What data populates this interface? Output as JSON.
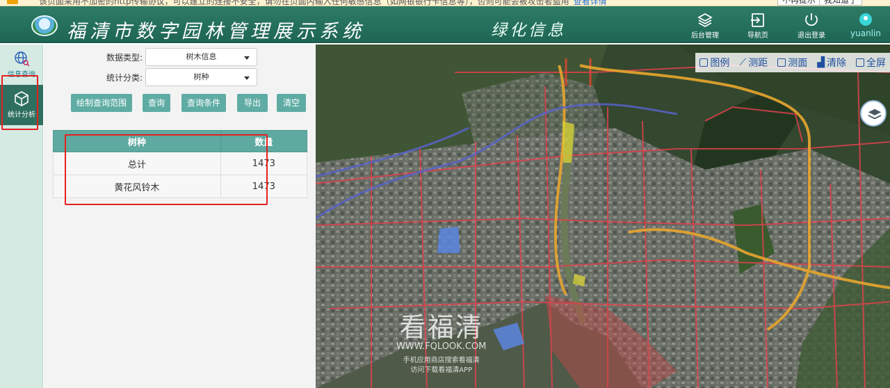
{
  "notice": {
    "text": "该页面采用不加密的http传输协议，可以建立的连接不安全，请勿在页面内输入任何敏感信息（如网银银行卡信息等），否则可能会被攻击者盗用",
    "link": "查看详情",
    "btn_no_remind": "不再提示",
    "btn_ok": "我知道了"
  },
  "header": {
    "title": "福清市数字园林管理展示系统",
    "subtitle": "绿化信息",
    "buttons": [
      {
        "label": "后台管理",
        "icon": "layers-icon"
      },
      {
        "label": "导航页",
        "icon": "enter-icon"
      },
      {
        "label": "退出登录",
        "icon": "power-icon"
      }
    ],
    "user": "yuanlin"
  },
  "rail": {
    "items": [
      {
        "label": "信息查询",
        "icon": "globe-search-icon"
      },
      {
        "label": "统计分析",
        "icon": "cube-icon"
      }
    ]
  },
  "form": {
    "data_type_label": "数据类型:",
    "data_type_value": "树木信息",
    "stat_label": "统计分类:",
    "stat_value": "树种"
  },
  "buttons": [
    "绘制查询范围",
    "查询",
    "查询条件",
    "导出",
    "清空"
  ],
  "table": {
    "headers": [
      "树种",
      "数量"
    ],
    "rows": [
      [
        "总计",
        "1473"
      ],
      [
        "黄花风铃木",
        "1473"
      ]
    ]
  },
  "map_tools": [
    "图例",
    "测距",
    "测面",
    "清除",
    "全屏"
  ],
  "watermark": {
    "big": "看福清",
    "url": "WWW.FQLOOK.COM",
    "line1": "手机应用商店搜索看福清",
    "line2": "访问下载看福清APP"
  },
  "colors": {
    "header": "#267262",
    "accent": "#5eaca4",
    "highlight": "#e5201f"
  }
}
